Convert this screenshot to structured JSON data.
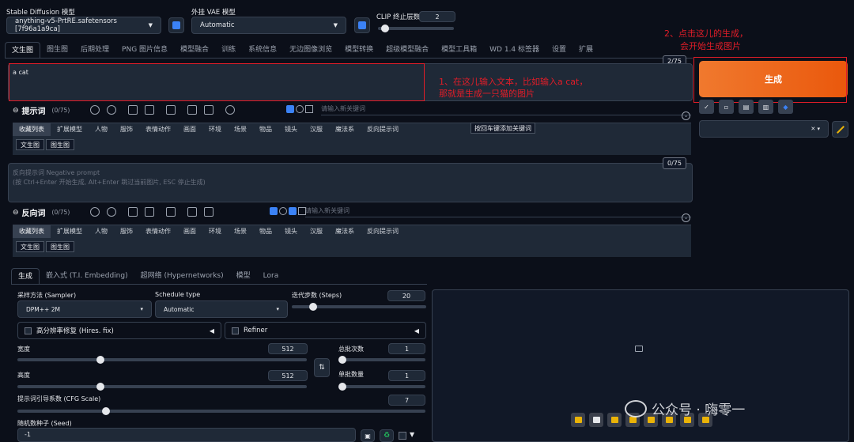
{
  "top": {
    "sd_model_label": "Stable Diffusion 模型",
    "sd_model_value": "anything-v5-PrtRE.safetensors [7f96a1a9ca]",
    "vae_label": "外挂 VAE 模型",
    "vae_value": "Automatic",
    "clip_label": "CLIP 终止层数",
    "clip_value": "2"
  },
  "main_tabs": [
    "文生图",
    "图生图",
    "后期处理",
    "PNG 图片信息",
    "模型融合",
    "训练",
    "系统信息",
    "无边图像浏览",
    "模型转换",
    "超级模型融合",
    "模型工具箱",
    "WD 1.4 标签器",
    "设置",
    "扩展"
  ],
  "prompt": {
    "text": "a cat",
    "counter": "2/75",
    "label": "提示词",
    "label_count": "(0/75)",
    "kw_placeholder": "请输入新关键词",
    "tooltip": "按回车键添加关键词"
  },
  "neg_prompt": {
    "placeholder_line1": "反向提示词 Negative prompt",
    "placeholder_line2": "(按 Ctrl+Enter 开始生成, Alt+Enter 跳过当前图片, ESC 停止生成)",
    "counter": "0/75",
    "label": "反向词",
    "label_count": "(0/75)",
    "kw_placeholder": "请输入新关键词"
  },
  "categories": [
    "收藏列表",
    "扩展模型",
    "人物",
    "服饰",
    "表情动作",
    "画面",
    "环境",
    "场景",
    "物品",
    "镜头",
    "汉服",
    "魔法系",
    "反向提示词"
  ],
  "subtabs": [
    "文生图",
    "图生图"
  ],
  "generate_button": "生成",
  "settings_tabs": [
    "生成",
    "嵌入式 (T.I. Embedding)",
    "超网络 (Hypernetworks)",
    "模型",
    "Lora"
  ],
  "settings": {
    "sampler_label": "采样方法 (Sampler)",
    "sampler_value": "DPM++ 2M",
    "schedule_label": "Schedule type",
    "schedule_value": "Automatic",
    "steps_label": "迭代步数 (Steps)",
    "steps_value": "20",
    "hires_label": "高分辨率修复 (Hires. fix)",
    "refiner_label": "Refiner",
    "width_label": "宽度",
    "width_value": "512",
    "height_label": "高度",
    "height_value": "512",
    "batch_count_label": "总批次数",
    "batch_count_value": "1",
    "batch_size_label": "单批数量",
    "batch_size_value": "1",
    "cfg_label": "提示词引导系数 (CFG Scale)",
    "cfg_value": "7",
    "seed_label": "随机数种子 (Seed)",
    "seed_value": "-1"
  },
  "annotations": {
    "a1_line1": "1、在这儿输入文本，比如输入a cat，",
    "a1_line2": "那就是生成一只猫的图片",
    "a2_line1": "2、点击这儿的生成，",
    "a2_line2": "会开始生成图片"
  },
  "watermark": "公众号 · 嗨零一",
  "colors": {
    "generate": "#ea580c",
    "annotation": "#e11d28",
    "accent": "#3b82f6"
  }
}
